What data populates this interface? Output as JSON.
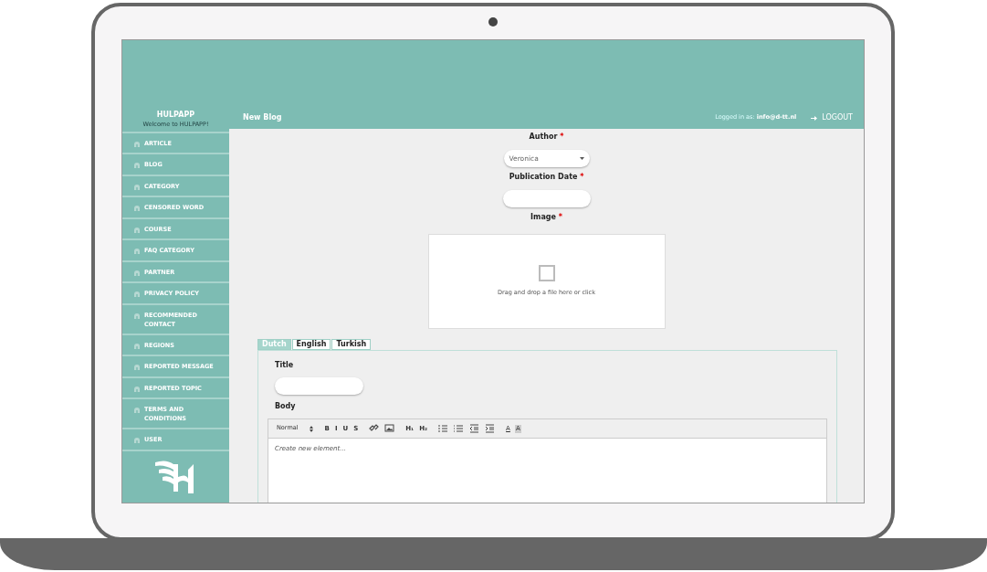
{
  "sidebar": {
    "brand": "HULPAPP",
    "welcome": "Welcome to HULPAPP!",
    "items": [
      {
        "label": "ARTICLE"
      },
      {
        "label": "BLOG"
      },
      {
        "label": "CATEGORY"
      },
      {
        "label": "CENSORED WORD"
      },
      {
        "label": "COURSE"
      },
      {
        "label": "FAQ CATEGORY"
      },
      {
        "label": "PARTNER"
      },
      {
        "label": "PRIVACY POLICY"
      },
      {
        "label": "RECOMMENDED CONTACT"
      },
      {
        "label": "REGIONS"
      },
      {
        "label": "REPORTED MESSAGE"
      },
      {
        "label": "REPORTED TOPIC"
      },
      {
        "label": "TERMS AND CONDITIONS"
      },
      {
        "label": "USER"
      }
    ]
  },
  "header": {
    "title": "New Blog",
    "logged_in_label": "Logged in as:",
    "user_email": "info@d-tt.nl",
    "logout": "LOGOUT"
  },
  "form": {
    "fields": [
      {
        "kind": "select",
        "label": "Author",
        "required_mark": "*",
        "value": "Veronica"
      },
      {
        "kind": "input",
        "label": "Publication Date",
        "required_mark": "*"
      },
      {
        "kind": "dropzone",
        "label": "Image",
        "required_mark": "*",
        "hint": "Drag and drop a file here or click"
      }
    ]
  },
  "tabs": [
    {
      "label": "Dutch",
      "selected": true
    },
    {
      "label": "English",
      "selected": false
    },
    {
      "label": "Turkish",
      "selected": false
    }
  ],
  "panel": {
    "title_label": "Title",
    "body_label": "Body",
    "editor": {
      "format": "Normal",
      "placeholder": "Create new element...",
      "tool_groups": [
        [
          {
            "kind": "text",
            "label": "B"
          },
          {
            "kind": "text",
            "label": "I"
          },
          {
            "kind": "text",
            "label": "U"
          },
          {
            "kind": "text",
            "label": "S"
          }
        ],
        [
          {
            "kind": "link"
          },
          {
            "kind": "image"
          }
        ],
        [
          {
            "kind": "text",
            "label": "H₁"
          },
          {
            "kind": "text",
            "label": "H₂"
          }
        ],
        [
          {
            "kind": "ordered-list"
          },
          {
            "kind": "bullet-list"
          },
          {
            "kind": "outdent"
          },
          {
            "kind": "indent"
          }
        ],
        [
          {
            "kind": "text-color",
            "label": "A"
          },
          {
            "kind": "background",
            "label": "A"
          }
        ]
      ]
    }
  }
}
